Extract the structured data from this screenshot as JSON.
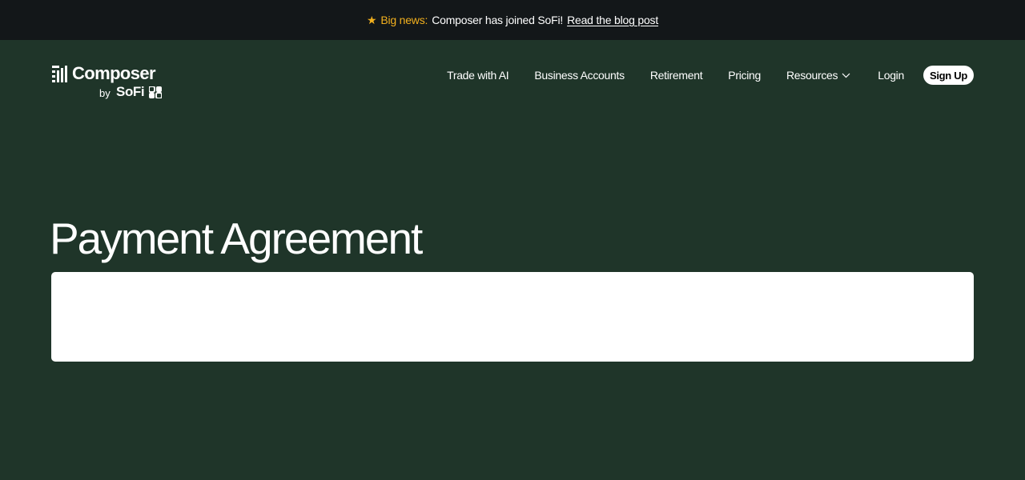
{
  "announcement": {
    "icon": "star-icon",
    "highlight": "Big news:",
    "message": "Composer has joined SoFi!",
    "link": "Read the blog post",
    "accent_color": "#f2b01e"
  },
  "logo": {
    "name": "Composer",
    "by": "by",
    "partner": "SoFi"
  },
  "nav": {
    "items": [
      {
        "label": "Trade with AI"
      },
      {
        "label": "Business Accounts"
      },
      {
        "label": "Retirement"
      },
      {
        "label": "Pricing"
      },
      {
        "label": "Resources",
        "icon": "chevron-down-icon"
      }
    ],
    "login": "Login",
    "signup": "Sign Up"
  },
  "page": {
    "title": "Payment Agreement",
    "background_color": "#1f3529"
  }
}
